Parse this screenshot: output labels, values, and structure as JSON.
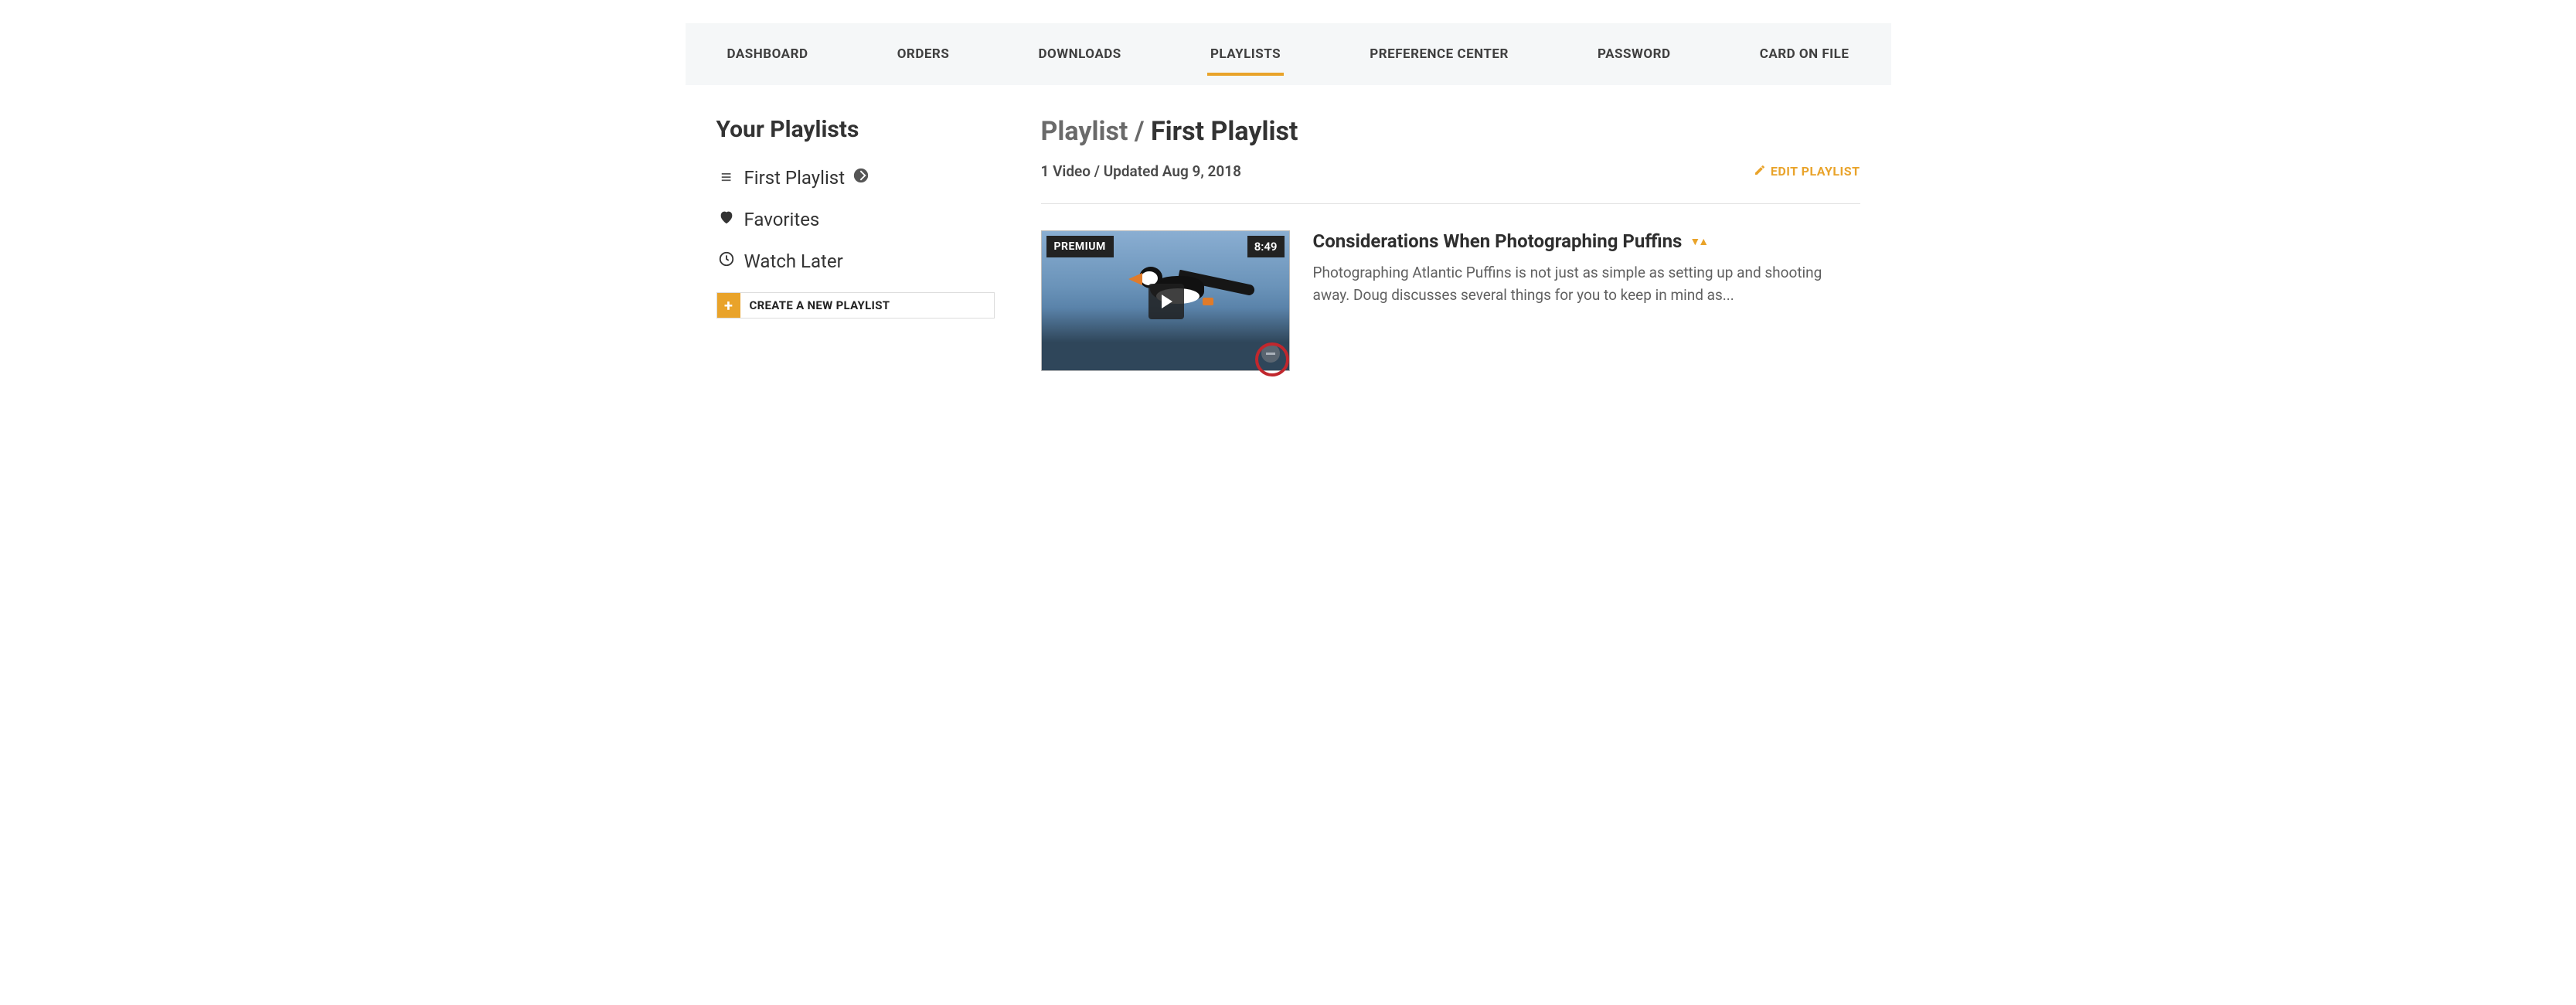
{
  "tabs": [
    {
      "label": "DASHBOARD",
      "active": false
    },
    {
      "label": "ORDERS",
      "active": false
    },
    {
      "label": "DOWNLOADS",
      "active": false
    },
    {
      "label": "PLAYLISTS",
      "active": true
    },
    {
      "label": "PREFERENCE CENTER",
      "active": false
    },
    {
      "label": "PASSWORD",
      "active": false
    },
    {
      "label": "CARD ON FILE",
      "active": false
    }
  ],
  "sidebar": {
    "title": "Your Playlists",
    "items": [
      {
        "icon": "menu-icon",
        "label": "First Playlist",
        "deletable": true
      },
      {
        "icon": "heart-icon",
        "label": "Favorites",
        "deletable": false
      },
      {
        "icon": "clock-icon",
        "label": "Watch Later",
        "deletable": false
      }
    ],
    "create_label": "CREATE A NEW PLAYLIST"
  },
  "main": {
    "crumb_prefix": "Playlist / ",
    "crumb_name": "First Playlist",
    "meta": "1 Video / Updated Aug 9, 2018",
    "edit_label": "EDIT PLAYLIST"
  },
  "video": {
    "premium_badge": "PREMIUM",
    "duration": "8:49",
    "title": "Considerations When Photographing Puffins",
    "desc": "Photographing Atlantic Puffins is not just as simple as setting up and shooting away. Doug discusses several things for you to keep in mind as..."
  }
}
